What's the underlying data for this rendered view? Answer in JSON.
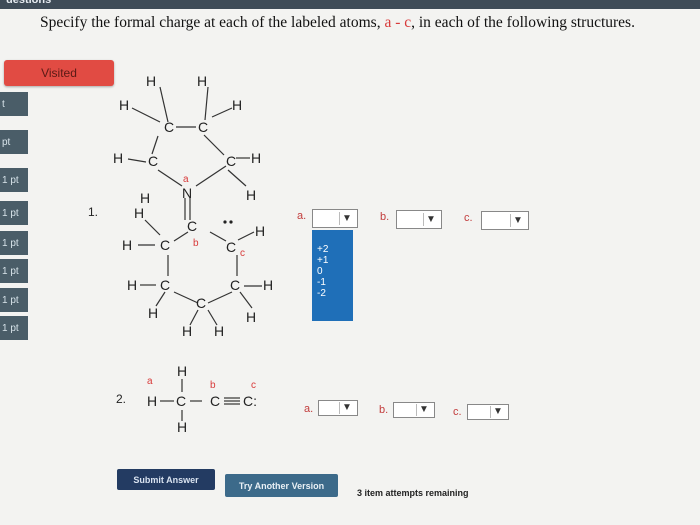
{
  "header": {
    "label": "uestions"
  },
  "instruction": {
    "prefix": "Specify the formal charge at each of the labeled atoms, ",
    "labels": "a - c",
    "suffix": ", in each of the following structures."
  },
  "visited_label": "Visited",
  "sidebar": {
    "items": [
      {
        "label": "t"
      },
      {
        "label": "pt"
      },
      {
        "label": "1 pt"
      },
      {
        "label": "1 pt"
      },
      {
        "label": "1 pt"
      },
      {
        "label": "1 pt"
      },
      {
        "label": "1 pt"
      },
      {
        "label": "1 pt"
      }
    ]
  },
  "q1": {
    "number": "1.",
    "dropdowns": [
      {
        "label": "a.",
        "value": ""
      },
      {
        "label": "b.",
        "value": ""
      },
      {
        "label": "c.",
        "value": ""
      }
    ],
    "options": [
      "+2",
      "+1",
      "0",
      "-1",
      "-2"
    ]
  },
  "q2": {
    "number": "2.",
    "dropdowns": [
      {
        "label": "a.",
        "value": ""
      },
      {
        "label": "b.",
        "value": ""
      },
      {
        "label": "c.",
        "value": ""
      }
    ]
  },
  "buttons": {
    "submit": "Submit Answer",
    "try_another": "Try Another Version"
  },
  "attempts": "3 item attempts remaining",
  "atoms": {
    "H": "H",
    "C": "C",
    "N": "N",
    "a": "a",
    "b": "b",
    "c": "c",
    "C_colon": "C:"
  },
  "colors": {
    "accent": "#e14b43",
    "sidebar": "#4a5d68",
    "label": "#c23c3c"
  }
}
